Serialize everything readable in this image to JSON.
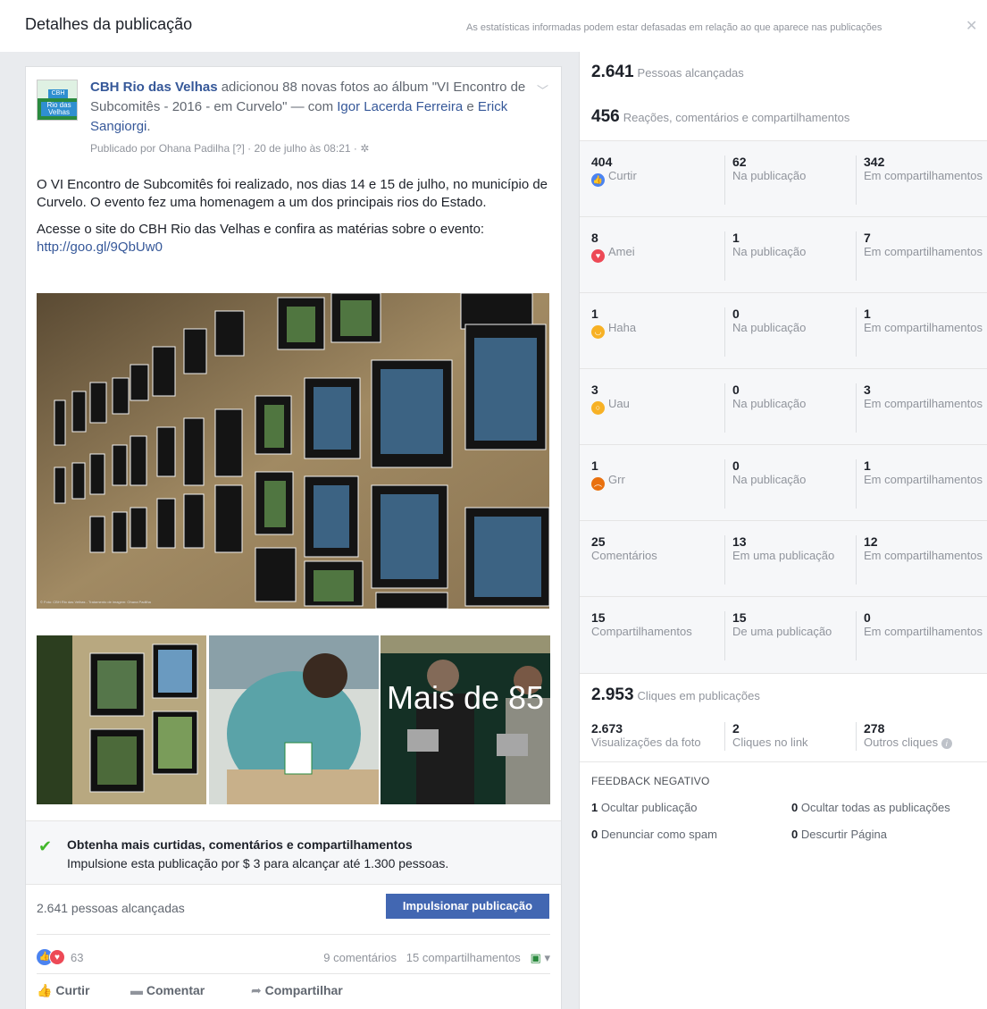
{
  "header": {
    "title": "Detalhes da publicação",
    "note": "As estatísticas informadas podem estar defasadas em relação ao que aparece nas publicações",
    "close": "✕"
  },
  "post": {
    "page_name": "CBH Rio das Velhas",
    "action_text": " adicionou 88 novas fotos ao álbum \"VI Encontro de Subcomitês - 2016 - em Curvelo\" — com ",
    "tagged_1": "Igor Lacerda Ferreira",
    "and": " e ",
    "tagged_2": "Erick Sangiorgi",
    "period": ".",
    "avatar_line1": "CBH",
    "avatar_line2": "Rio das Velhas",
    "meta": "Publicado por Ohana Padilha [?] · 20 de julho às 08:21 · ✲",
    "paragraph_1": "O VI Encontro de Subcomitês foi realizado, nos dias 14 e 15 de julho, no município de Curvelo. O evento fez uma homenagem a um dos principais rios do Estado.",
    "paragraph_2_text": "Acesse o site do CBH Rio das Velhas e confira as matérias sobre o evento: ",
    "paragraph_2_link": "http://goo.gl/9QbUw0",
    "more_photos": "Mais de 85",
    "photo_credit": "© Foto: CBH Rio das Velhas - Tratamento de imagem: Ohana Padilha"
  },
  "promo": {
    "title": "Obtenha mais curtidas, comentários e compartilhamentos",
    "subtitle": "Impulsione esta publicação por $ 3 para alcançar até 1.300 pessoas."
  },
  "reach_footer": {
    "reached": "2.641 pessoas alcançadas",
    "boost_button": "Impulsionar publicação"
  },
  "reactions_bar": {
    "count": "63",
    "comments": "9 comentários",
    "shares": "15 compartilhamentos"
  },
  "actions": {
    "like": "Curtir",
    "comment": "Comentar",
    "share": "Compartilhar"
  },
  "stats": {
    "reach_num": "2.641",
    "reach_label": "Pessoas alcançadas",
    "engage_num": "456",
    "engage_label": "Reações, comentários e compartilhamentos",
    "rows": [
      {
        "num": "404",
        "label": "Curtir",
        "emoji": "like",
        "color": "#4b83f0",
        "on_post": "62",
        "on_post_label": "Na publicação",
        "on_shares": "342",
        "on_shares_label": "Em compartilhamentos"
      },
      {
        "num": "8",
        "label": "Amei",
        "emoji": "love",
        "color": "#ed4956",
        "on_post": "1",
        "on_post_label": "Na publicação",
        "on_shares": "7",
        "on_shares_label": "Em compartilhamentos"
      },
      {
        "num": "1",
        "label": "Haha",
        "emoji": "haha",
        "color": "#f7b125",
        "on_post": "0",
        "on_post_label": "Na publicação",
        "on_shares": "1",
        "on_shares_label": "Em compartilhamentos"
      },
      {
        "num": "3",
        "label": "Uau",
        "emoji": "wow",
        "color": "#f7b125",
        "on_post": "0",
        "on_post_label": "Na publicação",
        "on_shares": "3",
        "on_shares_label": "Em compartilhamentos"
      },
      {
        "num": "1",
        "label": "Grr",
        "emoji": "angry",
        "color": "#e9710f",
        "on_post": "0",
        "on_post_label": "Na publicação",
        "on_shares": "1",
        "on_shares_label": "Em compartilhamentos"
      },
      {
        "num": "25",
        "label": "Comentários",
        "emoji": "",
        "color": "",
        "on_post": "13",
        "on_post_label": "Em uma publicação",
        "on_shares": "12",
        "on_shares_label": "Em compartilhamentos"
      },
      {
        "num": "15",
        "label": "Compartilhamentos",
        "emoji": "",
        "color": "",
        "on_post": "15",
        "on_post_label": "De uma publicação",
        "on_shares": "0",
        "on_shares_label": "Em compartilhamentos"
      }
    ],
    "clicks_num": "2.953",
    "clicks_label": "Cliques em publicações",
    "photo_views_num": "2.673",
    "photo_views_label": "Visualizações da foto",
    "link_clicks_num": "2",
    "link_clicks_label": "Cliques no link",
    "other_clicks_num": "278",
    "other_clicks_label": "Outros cliques",
    "negative_title": "FEEDBACK NEGATIVO",
    "hide_post_num": "1",
    "hide_post_label": "Ocultar publicação",
    "hide_all_num": "0",
    "hide_all_label": "Ocultar todas as publicações",
    "spam_num": "0",
    "spam_label": "Denunciar como spam",
    "unlike_num": "0",
    "unlike_label": "Descurtir Página"
  }
}
